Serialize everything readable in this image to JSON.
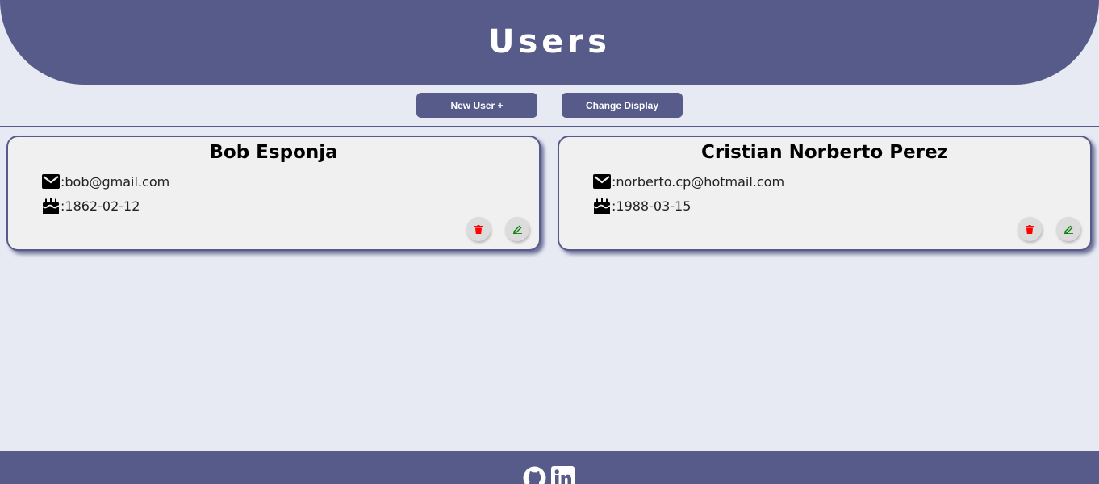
{
  "header": {
    "title": "Users"
  },
  "toolbar": {
    "new_user_label": "New User +",
    "change_display_label": "Change Display"
  },
  "users": [
    {
      "name": "Bob Esponja",
      "email": "bob@gmail.com",
      "birthdate": "1862-02-12"
    },
    {
      "name": "Cristian Norberto Perez",
      "email": "norberto.cp@hotmail.com",
      "birthdate": "1988-03-15"
    }
  ],
  "icons": {
    "email": "envelope-icon",
    "birthdate": "cake-icon",
    "delete": "trash-icon",
    "edit": "pencil-icon",
    "github": "github-icon",
    "linkedin": "linkedin-icon"
  },
  "colors": {
    "accent": "#575b89",
    "background": "#e7e9f3",
    "card": "#f0f0f0",
    "delete": "#ff0000",
    "edit": "#008000"
  }
}
